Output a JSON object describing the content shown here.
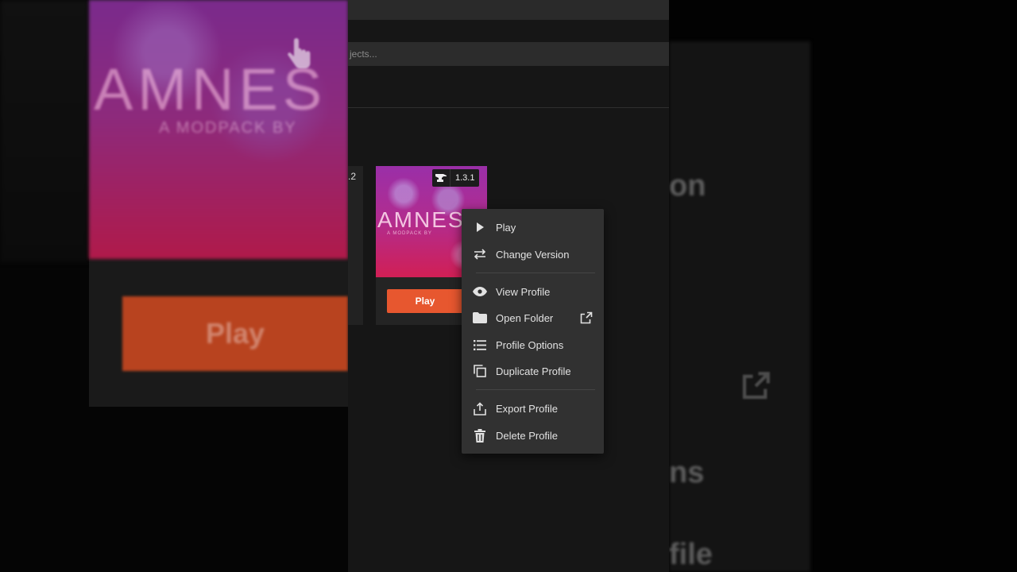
{
  "search": {
    "placeholder": "jects..."
  },
  "profiles": {
    "prev_version": ".2",
    "card": {
      "art_title": "AMNES",
      "art_subtitle": "A MODPACK BY",
      "version": "1.3.1",
      "play_label": "Play"
    }
  },
  "context_menu": {
    "items": [
      {
        "label": "Play",
        "icon": "play-icon"
      },
      {
        "label": "Change Version",
        "icon": "swap-icon"
      },
      {
        "label": "View Profile",
        "icon": "eye-icon"
      },
      {
        "label": "Open Folder",
        "icon": "folder-icon"
      },
      {
        "label": "Profile Options",
        "icon": "list-icon"
      },
      {
        "label": "Duplicate Profile",
        "icon": "duplicate-icon"
      },
      {
        "label": "Export Profile",
        "icon": "export-icon"
      },
      {
        "label": "Delete Profile",
        "icon": "trash-icon"
      }
    ]
  },
  "zoom_left": {
    "art_title": "AMNES",
    "art_subtitle": "A MODPACK BY",
    "play_label": "Play"
  },
  "zoom_right": {
    "text_1": "on",
    "text_2": "ns",
    "text_3": "file"
  },
  "colors": {
    "accent": "#e7572f",
    "menu_bg": "#313131",
    "window_bg": "#161616"
  }
}
